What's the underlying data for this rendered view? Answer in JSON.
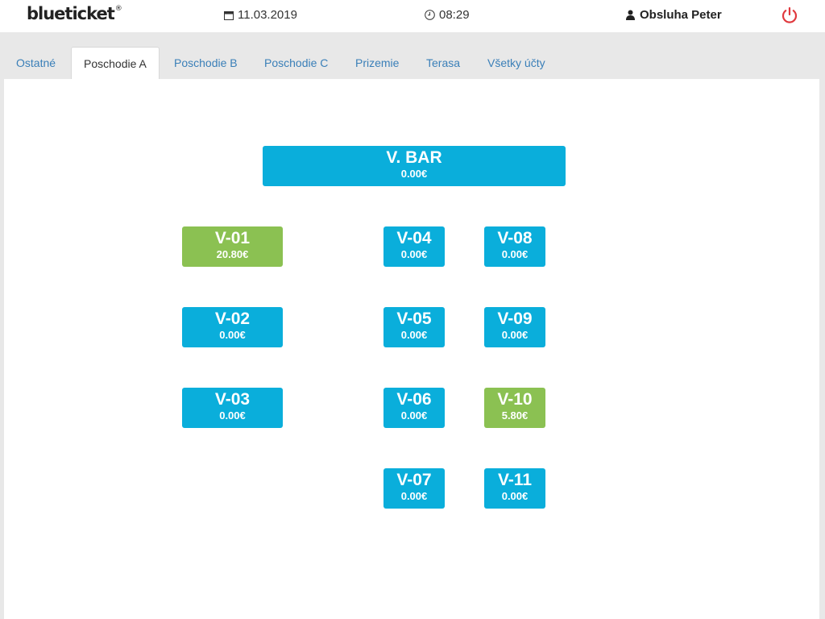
{
  "header": {
    "logo": "blueticket",
    "logo_mark": "®",
    "date": "11.03.2019",
    "time": "08:29",
    "user": "Obsluha Peter",
    "icons": {
      "date": "calendar-icon",
      "time": "clock-icon",
      "user": "user-icon",
      "power": "power-icon"
    },
    "colors": {
      "power": "#e0393e"
    }
  },
  "tabs": [
    {
      "label": "Ostatné",
      "active": false
    },
    {
      "label": "Poschodie A",
      "active": true
    },
    {
      "label": "Poschodie B",
      "active": false
    },
    {
      "label": "Poschodie C",
      "active": false
    },
    {
      "label": "Prizemie",
      "active": false
    },
    {
      "label": "Terasa",
      "active": false
    },
    {
      "label": "Všetky účty",
      "active": false
    }
  ],
  "tables": [
    {
      "name": "V. BAR",
      "amount": "0.00€",
      "status": "free"
    },
    {
      "name": "V-01",
      "amount": "20.80€",
      "status": "open"
    },
    {
      "name": "V-02",
      "amount": "0.00€",
      "status": "free"
    },
    {
      "name": "V-03",
      "amount": "0.00€",
      "status": "free"
    },
    {
      "name": "V-04",
      "amount": "0.00€",
      "status": "free"
    },
    {
      "name": "V-05",
      "amount": "0.00€",
      "status": "free"
    },
    {
      "name": "V-06",
      "amount": "0.00€",
      "status": "free"
    },
    {
      "name": "V-07",
      "amount": "0.00€",
      "status": "free"
    },
    {
      "name": "V-08",
      "amount": "0.00€",
      "status": "free"
    },
    {
      "name": "V-09",
      "amount": "0.00€",
      "status": "free"
    },
    {
      "name": "V-10",
      "amount": "5.80€",
      "status": "open"
    },
    {
      "name": "V-11",
      "amount": "0.00€",
      "status": "free"
    }
  ],
  "colors": {
    "free": "#0aaedb",
    "open": "#8bc152",
    "tab_link": "#3a7fb8"
  }
}
